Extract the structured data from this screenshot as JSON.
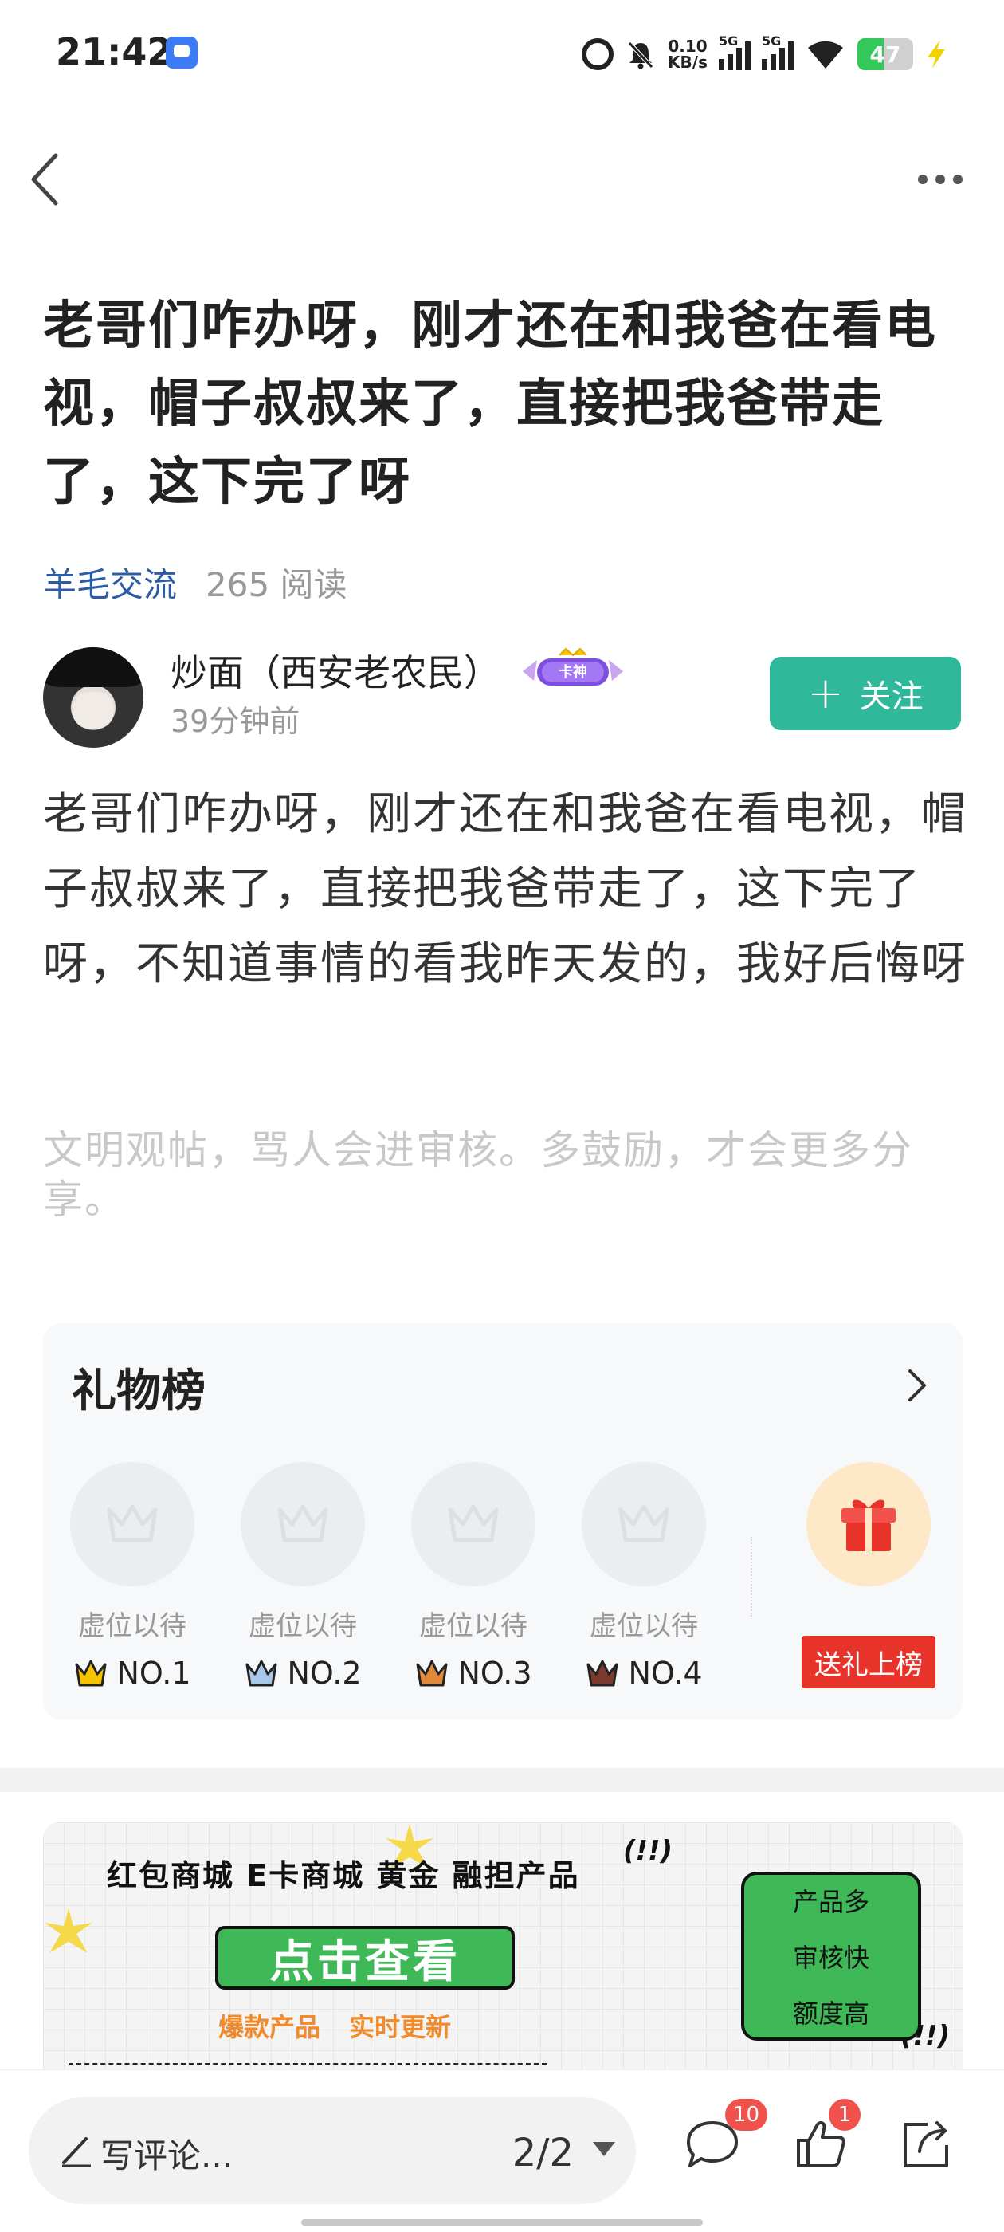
{
  "status_bar": {
    "time": "21:42",
    "net_speed_value": "0.10",
    "net_speed_unit": "KB/s",
    "signal1": "5G",
    "signal2": "5G",
    "battery": "47",
    "icons": [
      "app-icon",
      "alarm-icon",
      "mute-icon",
      "signal-icon",
      "wifi-icon",
      "battery-icon",
      "charging-icon"
    ]
  },
  "nav": {
    "icons": [
      "back-icon",
      "more-icon"
    ]
  },
  "post": {
    "title": "老哥们咋办呀，刚才还在和我爸在看电视，帽子叔叔来了，直接把我爸带走了，这下完了呀",
    "category": "羊毛交流",
    "reads": "265 阅读",
    "author": {
      "name": "炒面（西安老农民）",
      "badge": "卡神",
      "time": "39分钟前"
    },
    "follow_label": "关注",
    "body": "老哥们咋办呀，刚才还在和我爸在看电视，帽子叔叔来了，直接把我爸带走了，这下完了呀，不知道事情的看我昨天发的，我好后悔呀",
    "hint": "文明观帖，骂人会进审核。多鼓励，才会更多分享。"
  },
  "gift_board": {
    "title": "礼物榜",
    "slots": [
      {
        "placeholder": "虚位以待",
        "rank": "NO.1",
        "crown_color": "#f5c400"
      },
      {
        "placeholder": "虚位以待",
        "rank": "NO.2",
        "crown_color": "#a9c7e8"
      },
      {
        "placeholder": "虚位以待",
        "rank": "NO.3",
        "crown_color": "#e08a3c"
      },
      {
        "placeholder": "虚位以待",
        "rank": "NO.4",
        "crown_color": "#7a3b2e"
      }
    ],
    "send_label": "送礼上榜"
  },
  "ad": {
    "tags": "红包商城  E卡商城  黄金  融担产品",
    "exclaim": "(!!)",
    "cta": "点击查看",
    "sub1": "爆款产品",
    "sub2": "实时更新",
    "features": [
      "产品多",
      "审核快",
      "额度高"
    ],
    "colors": {
      "green": "#3fb857",
      "star": "#f5d94a",
      "orange": "#f08a2a"
    }
  },
  "bottom_bar": {
    "comment_placeholder": "写评论...",
    "pager": "2/2",
    "comment_count": "10",
    "like_count": "1",
    "icons": [
      "pen-icon",
      "comment-icon",
      "like-icon",
      "share-icon"
    ]
  },
  "colors": {
    "accent": "#2fb89a",
    "link": "#2a5ca8",
    "badge_red": "#f0524b",
    "gift_red": "#e8332b"
  }
}
